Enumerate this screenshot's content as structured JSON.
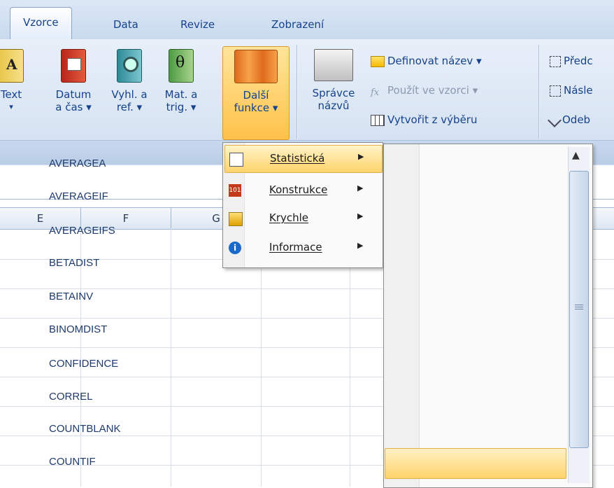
{
  "tabs": [
    {
      "label": "Vzorce",
      "active": true
    },
    {
      "label": "Data",
      "active": false
    },
    {
      "label": "Revize",
      "active": false
    },
    {
      "label": "Zobrazení",
      "active": false
    }
  ],
  "ribbon": {
    "text_btn": {
      "line1": "Text",
      "line2": "▾"
    },
    "datetime_btn": {
      "line1": "Datum",
      "line2": "a čas ▾"
    },
    "lookup_btn": {
      "line1": "Vyhl. a",
      "line2": "ref. ▾"
    },
    "math_btn": {
      "line1": "Mat. a",
      "line2": "trig. ▾"
    },
    "more_btn": {
      "line1": "Další",
      "line2": "funkce ▾"
    },
    "names_mgr_btn": {
      "line1": "Správce",
      "line2": "názvů"
    },
    "define_name": "Definovat název ▾",
    "use_in_formula": "Použít ve vzorci ▾",
    "create_from_sel": "Vytvořit z výběru",
    "trace_prec": "Předc",
    "trace_dep": "Násle",
    "remove_arrows": "Odeb"
  },
  "columns": [
    "E",
    "F",
    "G"
  ],
  "more_functions_menu": [
    {
      "label": "Statistická",
      "hot": true,
      "icon": "statistics-icon"
    },
    {
      "label": "Konstrukce",
      "hot": false,
      "icon": "engineering-icon"
    },
    {
      "label": "Krychle",
      "hot": false,
      "icon": "cube-icon"
    },
    {
      "label": "Informace",
      "hot": false,
      "icon": "information-icon"
    }
  ],
  "statistical_functions": [
    "AVERAGEA",
    "AVERAGEIF",
    "AVERAGEIFS",
    "BETADIST",
    "BETAINV",
    "BINOMDIST",
    "CONFIDENCE",
    "CORREL",
    "COUNTBLANK",
    "COUNTIF"
  ],
  "highlighted_function": "COUNTIF",
  "colors": {
    "accent_text": "#15428b",
    "hover_gold": "#ffd46b",
    "function_text": "#1e3a6b"
  }
}
